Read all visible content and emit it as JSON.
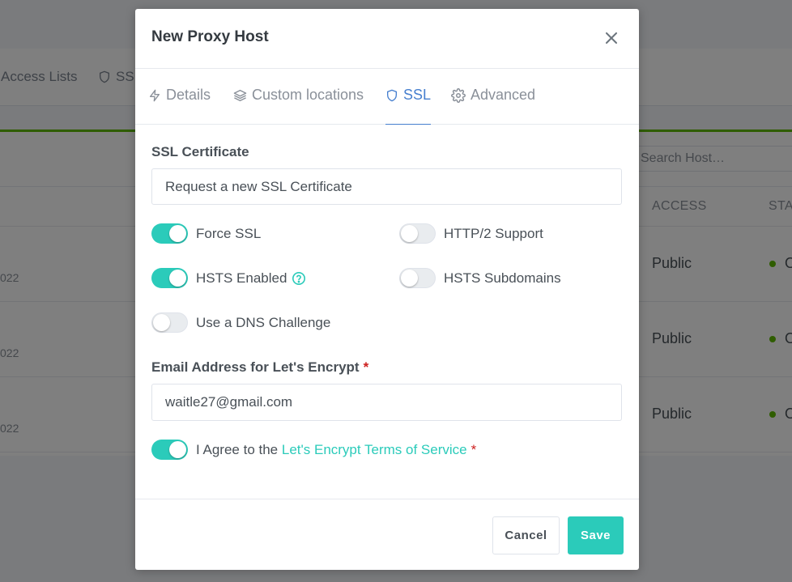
{
  "background": {
    "nav_items": [
      {
        "label": "Access Lists"
      },
      {
        "label": "SSL"
      }
    ],
    "search_placeholder": "Search Host…",
    "table_headers": {
      "access": "ACCESS",
      "status": "STAT"
    },
    "rows": [
      {
        "date": "022",
        "access": "Public",
        "status": "O"
      },
      {
        "date": "022",
        "access": "Public",
        "status": "O"
      },
      {
        "date": "022",
        "access": "Public",
        "status": "O"
      }
    ]
  },
  "modal": {
    "title": "New Proxy Host",
    "tabs": [
      {
        "label": "Details",
        "icon": "bolt-icon"
      },
      {
        "label": "Custom locations",
        "icon": "layers-icon"
      },
      {
        "label": "SSL",
        "icon": "shield-icon"
      },
      {
        "label": "Advanced",
        "icon": "gear-icon"
      }
    ],
    "active_tab": "SSL",
    "ssl_certificate_label": "SSL Certificate",
    "ssl_certificate_value": "Request a new SSL Certificate",
    "toggles": {
      "force_ssl": {
        "label": "Force SSL",
        "on": true
      },
      "http2": {
        "label": "HTTP/2 Support",
        "on": false
      },
      "hsts": {
        "label": "HSTS Enabled",
        "on": true
      },
      "hsts_sub": {
        "label": "HSTS Subdomains",
        "on": false
      },
      "dns": {
        "label": "Use a DNS Challenge",
        "on": false
      }
    },
    "email_label": "Email Address for Let's Encrypt",
    "required_mark": "*",
    "email_value": "waitle27@gmail.com",
    "agree_prefix": "I Agree to the",
    "agree_link": "Let's Encrypt Terms of Service",
    "agree_on": true,
    "cancel_label": "Cancel",
    "save_label": "Save"
  },
  "colors": {
    "accent": "#2bcbba",
    "active_tab": "#467fcf",
    "required": "#cd201f",
    "status_green": "#5eba00"
  }
}
